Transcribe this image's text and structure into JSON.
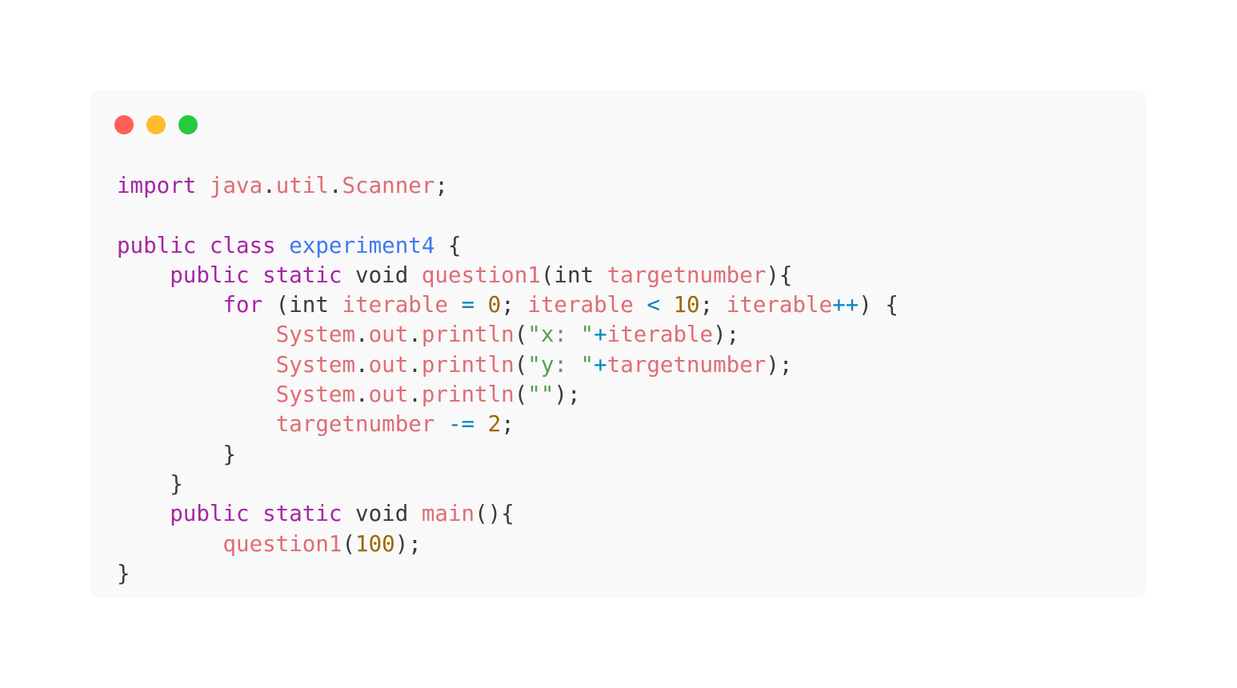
{
  "window": {
    "controls": [
      {
        "name": "close-button",
        "color": "#ff5f56"
      },
      {
        "name": "minimize-button",
        "color": "#ffbd2e"
      },
      {
        "name": "maximize-button",
        "color": "#27c93f"
      }
    ]
  },
  "code": {
    "language": "java",
    "lines": [
      [
        {
          "t": "import",
          "k": "keyword"
        },
        {
          "t": " ",
          "k": "plain"
        },
        {
          "t": "java",
          "k": "ident"
        },
        {
          "t": ".",
          "k": "punct"
        },
        {
          "t": "util",
          "k": "ident"
        },
        {
          "t": ".",
          "k": "punct"
        },
        {
          "t": "Scanner",
          "k": "ident"
        },
        {
          "t": ";",
          "k": "punct"
        }
      ],
      [],
      [
        {
          "t": "public",
          "k": "keyword"
        },
        {
          "t": " ",
          "k": "plain"
        },
        {
          "t": "class",
          "k": "keyword"
        },
        {
          "t": " ",
          "k": "plain"
        },
        {
          "t": "experiment4",
          "k": "class"
        },
        {
          "t": " {",
          "k": "punct"
        }
      ],
      [
        {
          "t": "    ",
          "k": "plain"
        },
        {
          "t": "public",
          "k": "keyword"
        },
        {
          "t": " ",
          "k": "plain"
        },
        {
          "t": "static",
          "k": "keyword"
        },
        {
          "t": " ",
          "k": "plain"
        },
        {
          "t": "void",
          "k": "plain"
        },
        {
          "t": " ",
          "k": "plain"
        },
        {
          "t": "question1",
          "k": "ident"
        },
        {
          "t": "(",
          "k": "punct"
        },
        {
          "t": "int",
          "k": "plain"
        },
        {
          "t": " ",
          "k": "plain"
        },
        {
          "t": "targetnumber",
          "k": "ident"
        },
        {
          "t": "){",
          "k": "punct"
        }
      ],
      [
        {
          "t": "        ",
          "k": "plain"
        },
        {
          "t": "for",
          "k": "keyword"
        },
        {
          "t": " (",
          "k": "punct"
        },
        {
          "t": "int",
          "k": "plain"
        },
        {
          "t": " ",
          "k": "plain"
        },
        {
          "t": "iterable",
          "k": "ident"
        },
        {
          "t": " ",
          "k": "plain"
        },
        {
          "t": "=",
          "k": "op"
        },
        {
          "t": " ",
          "k": "plain"
        },
        {
          "t": "0",
          "k": "number"
        },
        {
          "t": "; ",
          "k": "punct"
        },
        {
          "t": "iterable",
          "k": "ident"
        },
        {
          "t": " ",
          "k": "plain"
        },
        {
          "t": "<",
          "k": "op"
        },
        {
          "t": " ",
          "k": "plain"
        },
        {
          "t": "10",
          "k": "number"
        },
        {
          "t": "; ",
          "k": "punct"
        },
        {
          "t": "iterable",
          "k": "ident"
        },
        {
          "t": "++",
          "k": "op"
        },
        {
          "t": ") {",
          "k": "punct"
        }
      ],
      [
        {
          "t": "            ",
          "k": "plain"
        },
        {
          "t": "System",
          "k": "ident"
        },
        {
          "t": ".",
          "k": "punct"
        },
        {
          "t": "out",
          "k": "ident"
        },
        {
          "t": ".",
          "k": "punct"
        },
        {
          "t": "println",
          "k": "ident"
        },
        {
          "t": "(",
          "k": "punct"
        },
        {
          "t": "\"x: \"",
          "k": "string"
        },
        {
          "t": "+",
          "k": "op"
        },
        {
          "t": "iterable",
          "k": "ident"
        },
        {
          "t": ");",
          "k": "punct"
        }
      ],
      [
        {
          "t": "            ",
          "k": "plain"
        },
        {
          "t": "System",
          "k": "ident"
        },
        {
          "t": ".",
          "k": "punct"
        },
        {
          "t": "out",
          "k": "ident"
        },
        {
          "t": ".",
          "k": "punct"
        },
        {
          "t": "println",
          "k": "ident"
        },
        {
          "t": "(",
          "k": "punct"
        },
        {
          "t": "\"y: \"",
          "k": "string"
        },
        {
          "t": "+",
          "k": "op"
        },
        {
          "t": "targetnumber",
          "k": "ident"
        },
        {
          "t": ");",
          "k": "punct"
        }
      ],
      [
        {
          "t": "            ",
          "k": "plain"
        },
        {
          "t": "System",
          "k": "ident"
        },
        {
          "t": ".",
          "k": "punct"
        },
        {
          "t": "out",
          "k": "ident"
        },
        {
          "t": ".",
          "k": "punct"
        },
        {
          "t": "println",
          "k": "ident"
        },
        {
          "t": "(",
          "k": "punct"
        },
        {
          "t": "\"\"",
          "k": "string"
        },
        {
          "t": ");",
          "k": "punct"
        }
      ],
      [
        {
          "t": "            ",
          "k": "plain"
        },
        {
          "t": "targetnumber",
          "k": "ident"
        },
        {
          "t": " ",
          "k": "plain"
        },
        {
          "t": "-=",
          "k": "op"
        },
        {
          "t": " ",
          "k": "plain"
        },
        {
          "t": "2",
          "k": "number"
        },
        {
          "t": ";",
          "k": "punct"
        }
      ],
      [
        {
          "t": "        ",
          "k": "plain"
        },
        {
          "t": "}",
          "k": "punct"
        }
      ],
      [
        {
          "t": "    ",
          "k": "plain"
        },
        {
          "t": "}",
          "k": "punct"
        }
      ],
      [
        {
          "t": "    ",
          "k": "plain"
        },
        {
          "t": "public",
          "k": "keyword"
        },
        {
          "t": " ",
          "k": "plain"
        },
        {
          "t": "static",
          "k": "keyword"
        },
        {
          "t": " ",
          "k": "plain"
        },
        {
          "t": "void",
          "k": "plain"
        },
        {
          "t": " ",
          "k": "plain"
        },
        {
          "t": "main",
          "k": "ident"
        },
        {
          "t": "(){",
          "k": "punct"
        }
      ],
      [
        {
          "t": "        ",
          "k": "plain"
        },
        {
          "t": "question1",
          "k": "ident"
        },
        {
          "t": "(",
          "k": "punct"
        },
        {
          "t": "100",
          "k": "number"
        },
        {
          "t": ");",
          "k": "punct"
        }
      ],
      [
        {
          "t": "}",
          "k": "punct"
        }
      ]
    ]
  }
}
